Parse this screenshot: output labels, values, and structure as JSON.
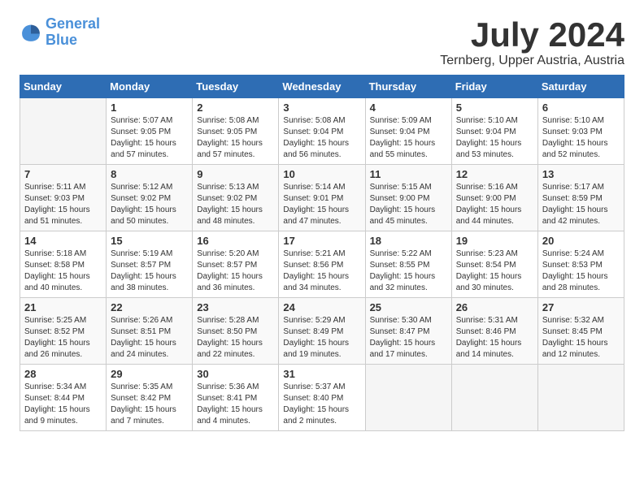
{
  "logo": {
    "line1": "General",
    "line2": "Blue"
  },
  "title": "July 2024",
  "subtitle": "Ternberg, Upper Austria, Austria",
  "days_header": [
    "Sunday",
    "Monday",
    "Tuesday",
    "Wednesday",
    "Thursday",
    "Friday",
    "Saturday"
  ],
  "weeks": [
    [
      {
        "day": "",
        "info": ""
      },
      {
        "day": "1",
        "info": "Sunrise: 5:07 AM\nSunset: 9:05 PM\nDaylight: 15 hours\nand 57 minutes."
      },
      {
        "day": "2",
        "info": "Sunrise: 5:08 AM\nSunset: 9:05 PM\nDaylight: 15 hours\nand 57 minutes."
      },
      {
        "day": "3",
        "info": "Sunrise: 5:08 AM\nSunset: 9:04 PM\nDaylight: 15 hours\nand 56 minutes."
      },
      {
        "day": "4",
        "info": "Sunrise: 5:09 AM\nSunset: 9:04 PM\nDaylight: 15 hours\nand 55 minutes."
      },
      {
        "day": "5",
        "info": "Sunrise: 5:10 AM\nSunset: 9:04 PM\nDaylight: 15 hours\nand 53 minutes."
      },
      {
        "day": "6",
        "info": "Sunrise: 5:10 AM\nSunset: 9:03 PM\nDaylight: 15 hours\nand 52 minutes."
      }
    ],
    [
      {
        "day": "7",
        "info": "Sunrise: 5:11 AM\nSunset: 9:03 PM\nDaylight: 15 hours\nand 51 minutes."
      },
      {
        "day": "8",
        "info": "Sunrise: 5:12 AM\nSunset: 9:02 PM\nDaylight: 15 hours\nand 50 minutes."
      },
      {
        "day": "9",
        "info": "Sunrise: 5:13 AM\nSunset: 9:02 PM\nDaylight: 15 hours\nand 48 minutes."
      },
      {
        "day": "10",
        "info": "Sunrise: 5:14 AM\nSunset: 9:01 PM\nDaylight: 15 hours\nand 47 minutes."
      },
      {
        "day": "11",
        "info": "Sunrise: 5:15 AM\nSunset: 9:00 PM\nDaylight: 15 hours\nand 45 minutes."
      },
      {
        "day": "12",
        "info": "Sunrise: 5:16 AM\nSunset: 9:00 PM\nDaylight: 15 hours\nand 44 minutes."
      },
      {
        "day": "13",
        "info": "Sunrise: 5:17 AM\nSunset: 8:59 PM\nDaylight: 15 hours\nand 42 minutes."
      }
    ],
    [
      {
        "day": "14",
        "info": "Sunrise: 5:18 AM\nSunset: 8:58 PM\nDaylight: 15 hours\nand 40 minutes."
      },
      {
        "day": "15",
        "info": "Sunrise: 5:19 AM\nSunset: 8:57 PM\nDaylight: 15 hours\nand 38 minutes."
      },
      {
        "day": "16",
        "info": "Sunrise: 5:20 AM\nSunset: 8:57 PM\nDaylight: 15 hours\nand 36 minutes."
      },
      {
        "day": "17",
        "info": "Sunrise: 5:21 AM\nSunset: 8:56 PM\nDaylight: 15 hours\nand 34 minutes."
      },
      {
        "day": "18",
        "info": "Sunrise: 5:22 AM\nSunset: 8:55 PM\nDaylight: 15 hours\nand 32 minutes."
      },
      {
        "day": "19",
        "info": "Sunrise: 5:23 AM\nSunset: 8:54 PM\nDaylight: 15 hours\nand 30 minutes."
      },
      {
        "day": "20",
        "info": "Sunrise: 5:24 AM\nSunset: 8:53 PM\nDaylight: 15 hours\nand 28 minutes."
      }
    ],
    [
      {
        "day": "21",
        "info": "Sunrise: 5:25 AM\nSunset: 8:52 PM\nDaylight: 15 hours\nand 26 minutes."
      },
      {
        "day": "22",
        "info": "Sunrise: 5:26 AM\nSunset: 8:51 PM\nDaylight: 15 hours\nand 24 minutes."
      },
      {
        "day": "23",
        "info": "Sunrise: 5:28 AM\nSunset: 8:50 PM\nDaylight: 15 hours\nand 22 minutes."
      },
      {
        "day": "24",
        "info": "Sunrise: 5:29 AM\nSunset: 8:49 PM\nDaylight: 15 hours\nand 19 minutes."
      },
      {
        "day": "25",
        "info": "Sunrise: 5:30 AM\nSunset: 8:47 PM\nDaylight: 15 hours\nand 17 minutes."
      },
      {
        "day": "26",
        "info": "Sunrise: 5:31 AM\nSunset: 8:46 PM\nDaylight: 15 hours\nand 14 minutes."
      },
      {
        "day": "27",
        "info": "Sunrise: 5:32 AM\nSunset: 8:45 PM\nDaylight: 15 hours\nand 12 minutes."
      }
    ],
    [
      {
        "day": "28",
        "info": "Sunrise: 5:34 AM\nSunset: 8:44 PM\nDaylight: 15 hours\nand 9 minutes."
      },
      {
        "day": "29",
        "info": "Sunrise: 5:35 AM\nSunset: 8:42 PM\nDaylight: 15 hours\nand 7 minutes."
      },
      {
        "day": "30",
        "info": "Sunrise: 5:36 AM\nSunset: 8:41 PM\nDaylight: 15 hours\nand 4 minutes."
      },
      {
        "day": "31",
        "info": "Sunrise: 5:37 AM\nSunset: 8:40 PM\nDaylight: 15 hours\nand 2 minutes."
      },
      {
        "day": "",
        "info": ""
      },
      {
        "day": "",
        "info": ""
      },
      {
        "day": "",
        "info": ""
      }
    ]
  ]
}
